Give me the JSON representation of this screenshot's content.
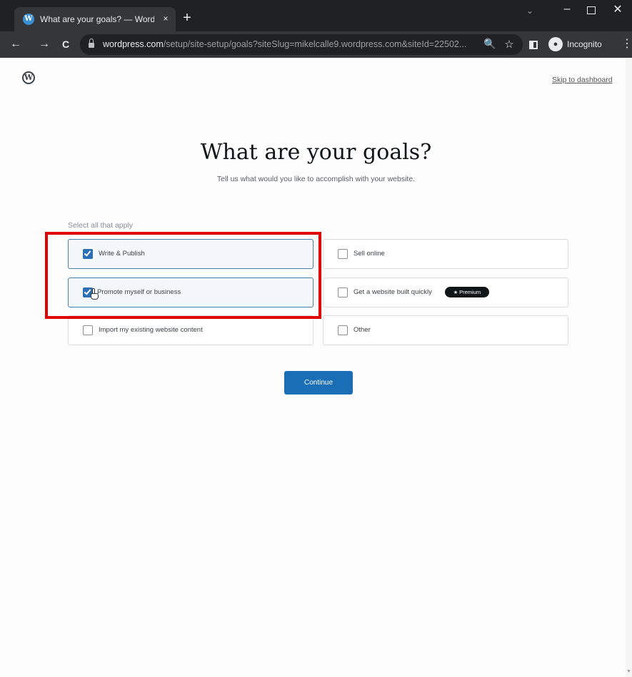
{
  "browser": {
    "tab": {
      "title": "What are your goals? — WordPr",
      "close_glyph": "×"
    },
    "new_tab_glyph": "+",
    "window_controls": {
      "chevron_glyph": "⌄",
      "minimize_glyph": "–",
      "close_glyph": "✕"
    },
    "nav": {
      "back_glyph": "←",
      "forward_glyph": "→",
      "reload_glyph": "C"
    },
    "address": {
      "host": "wordpress.com",
      "path": "/setup/site-setup/goals?siteSlug=mikelcalle9.wordpress.com&siteId=22502..."
    },
    "icons": {
      "zoom": "zoom-icon",
      "bookmark": "star-icon",
      "side_panel": "side-panel-icon",
      "incognito": "incognito-icon",
      "menu": "kebab-menu-icon"
    },
    "zoom_glyph": "🔍",
    "star_glyph": "☆",
    "incognito_label": "Incognito",
    "incognito_avatar_glyph": "●",
    "menu_glyph": "⋮"
  },
  "page": {
    "logo_glyph": "W",
    "skip_link": "Skip to dashboard",
    "heading": "What are your goals?",
    "subheading": "Tell us what would you like to accomplish with your website.",
    "select_label": "Select all that apply",
    "options": {
      "write": {
        "label": "Write & Publish",
        "checked": true
      },
      "sell": {
        "label": "Sell online",
        "checked": false
      },
      "promote": {
        "label": "Promote myself or business",
        "checked": true
      },
      "builder": {
        "label": "Get a website built quickly",
        "checked": false,
        "badge": "Premium",
        "badge_glyph": "★"
      },
      "import": {
        "label": "Import my existing website content",
        "checked": false
      },
      "other": {
        "label": "Other",
        "checked": false
      }
    },
    "continue_label": "Continue"
  },
  "colors": {
    "accent": "#1a6eb6",
    "checked_box": "#2c6fb3",
    "highlight": "#e00000",
    "chrome_dark": "#202124",
    "chrome_toolbar": "#35363a"
  },
  "scroll_arrow_glyph": "▼"
}
